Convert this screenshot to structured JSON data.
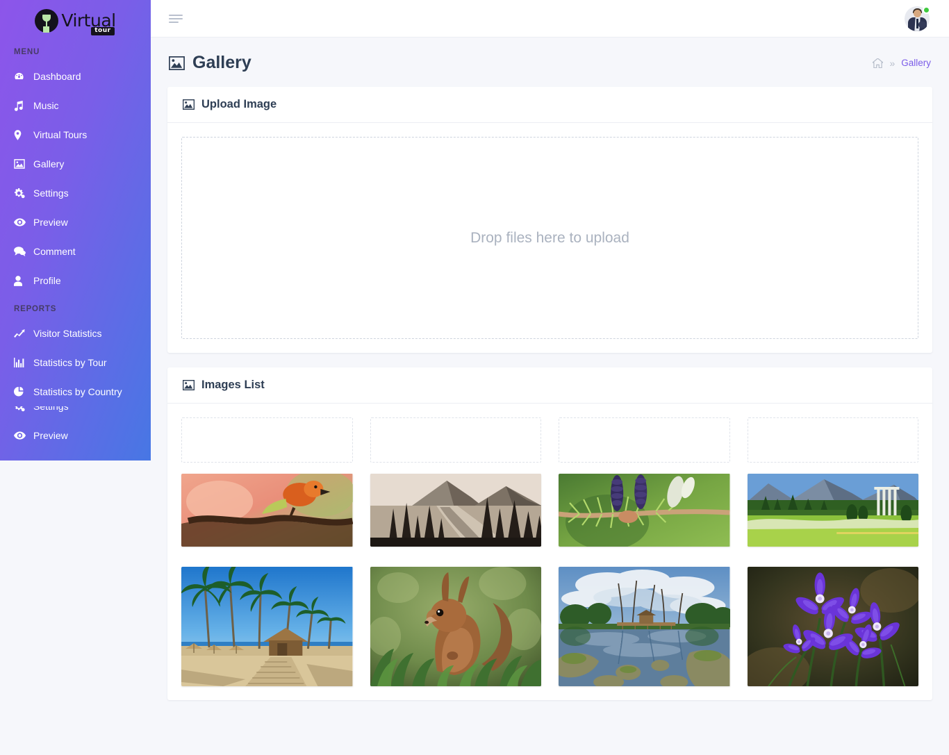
{
  "brand": {
    "name": "Virtual",
    "sub": "tour",
    "icon": "wine-glass-icon"
  },
  "sidebar": {
    "sections": [
      {
        "label": "MENU",
        "items": [
          {
            "label": "Dashboard",
            "icon": "dashboard-icon"
          },
          {
            "label": "Music",
            "icon": "music-note-icon"
          },
          {
            "label": "Virtual Tours",
            "icon": "map-marker-icon"
          },
          {
            "label": "Gallery",
            "icon": "image-icon"
          },
          {
            "label": "Settings",
            "icon": "cogs-icon"
          },
          {
            "label": "Preview",
            "icon": "eye-icon"
          },
          {
            "label": "Comment",
            "icon": "comment-icon"
          },
          {
            "label": "Profile",
            "icon": "user-icon"
          }
        ]
      },
      {
        "label": "REPORTS",
        "items": [
          {
            "label": "Visitor Statistics",
            "icon": "line-chart-icon"
          },
          {
            "label": "Statistics by Tour",
            "icon": "bar-chart-icon"
          },
          {
            "label": "Statistics by Country",
            "icon": "pie-chart-icon"
          }
        ]
      }
    ],
    "clipped_items": [
      {
        "label": "Settings",
        "icon": "cogs-icon"
      },
      {
        "label": "Preview",
        "icon": "eye-icon"
      }
    ]
  },
  "topbar": {
    "menu_toggle": "hamburger-icon",
    "avatar": "user-avatar",
    "status": "online"
  },
  "page": {
    "title": "Gallery",
    "title_icon": "image-icon",
    "breadcrumb": {
      "home_icon": "home-icon",
      "separator": "»",
      "current": "Gallery"
    }
  },
  "upload_card": {
    "title": "Upload Image",
    "icon": "image-icon",
    "dropzone_text": "Drop files here to upload"
  },
  "images_card": {
    "title": "Images List",
    "icon": "image-icon",
    "placeholder_count": 4,
    "images": [
      {
        "name": "robin-bird-on-branch",
        "alt": "Orange robin perched on a branch with pink bokeh background"
      },
      {
        "name": "mountain-road-trees",
        "alt": "Dark conifer trees lining a road with mountain behind"
      },
      {
        "name": "spruce-cones-branch",
        "alt": "Blue-purple spruce cones on a green needled branch"
      },
      {
        "name": "garden-lawn-mountains",
        "alt": "Manicured garden lawn with trees and mountain backdrop"
      },
      {
        "name": "palm-beach-boardwalk",
        "alt": "Palm trees over a sandy beach boardwalk under blue sky"
      },
      {
        "name": "red-squirrel-grass",
        "alt": "Red squirrel standing in green grass"
      },
      {
        "name": "pond-reflection-park",
        "alt": "Park pond reflecting clouds and trees with mossy rocks"
      },
      {
        "name": "purple-hepatica-flowers",
        "alt": "Purple hepatica flowers on dark green background"
      }
    ]
  },
  "colors": {
    "sidebar_gradient_start": "#8d55ea",
    "sidebar_gradient_end": "#4777e4",
    "accent": "#7b5ce8",
    "page_bg": "#f6f7fb",
    "card_bg": "#ffffff",
    "heading": "#2e3e54",
    "muted": "#aab2bf",
    "status_online": "#3ec93e"
  }
}
